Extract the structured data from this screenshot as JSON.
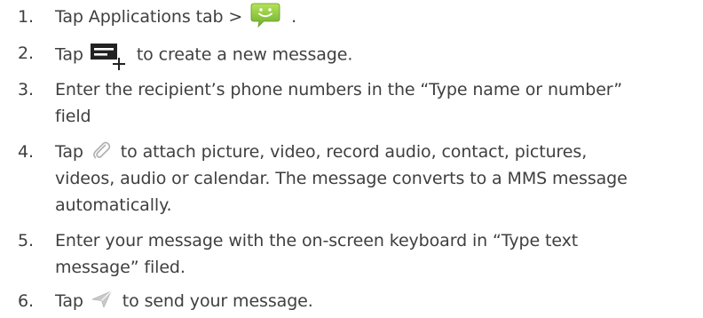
{
  "steps": [
    {
      "number": "1.",
      "before": "Tap Applications tab > ",
      "icon": "messaging-app-icon",
      "after": " ."
    },
    {
      "number": "2.",
      "before": "Tap ",
      "icon": "new-message-icon",
      "after": "to create a new message."
    },
    {
      "number": "3.",
      "line1": "Enter the recipient’s phone numbers in the “Type name or number”",
      "line2": "field"
    },
    {
      "number": "4.",
      "before": "Tap ",
      "icon": "paperclip-icon",
      "after": " to attach picture, video, record audio, contact, pictures,",
      "line2": "videos, audio or calendar. The message converts to a MMS message",
      "line3": "automatically."
    },
    {
      "number": "5.",
      "line1": "Enter your message with the on-screen keyboard in “Type text",
      "line2": "message” filed."
    },
    {
      "number": "6.",
      "before": "Tap ",
      "icon": "send-icon",
      "after": " to send your message."
    }
  ],
  "colors": {
    "text": "#3f3f3f",
    "messaging_icon_green": "#8bc34a",
    "new_message_icon": "#2e9a34",
    "icon_gray": "#b5b5b5"
  }
}
